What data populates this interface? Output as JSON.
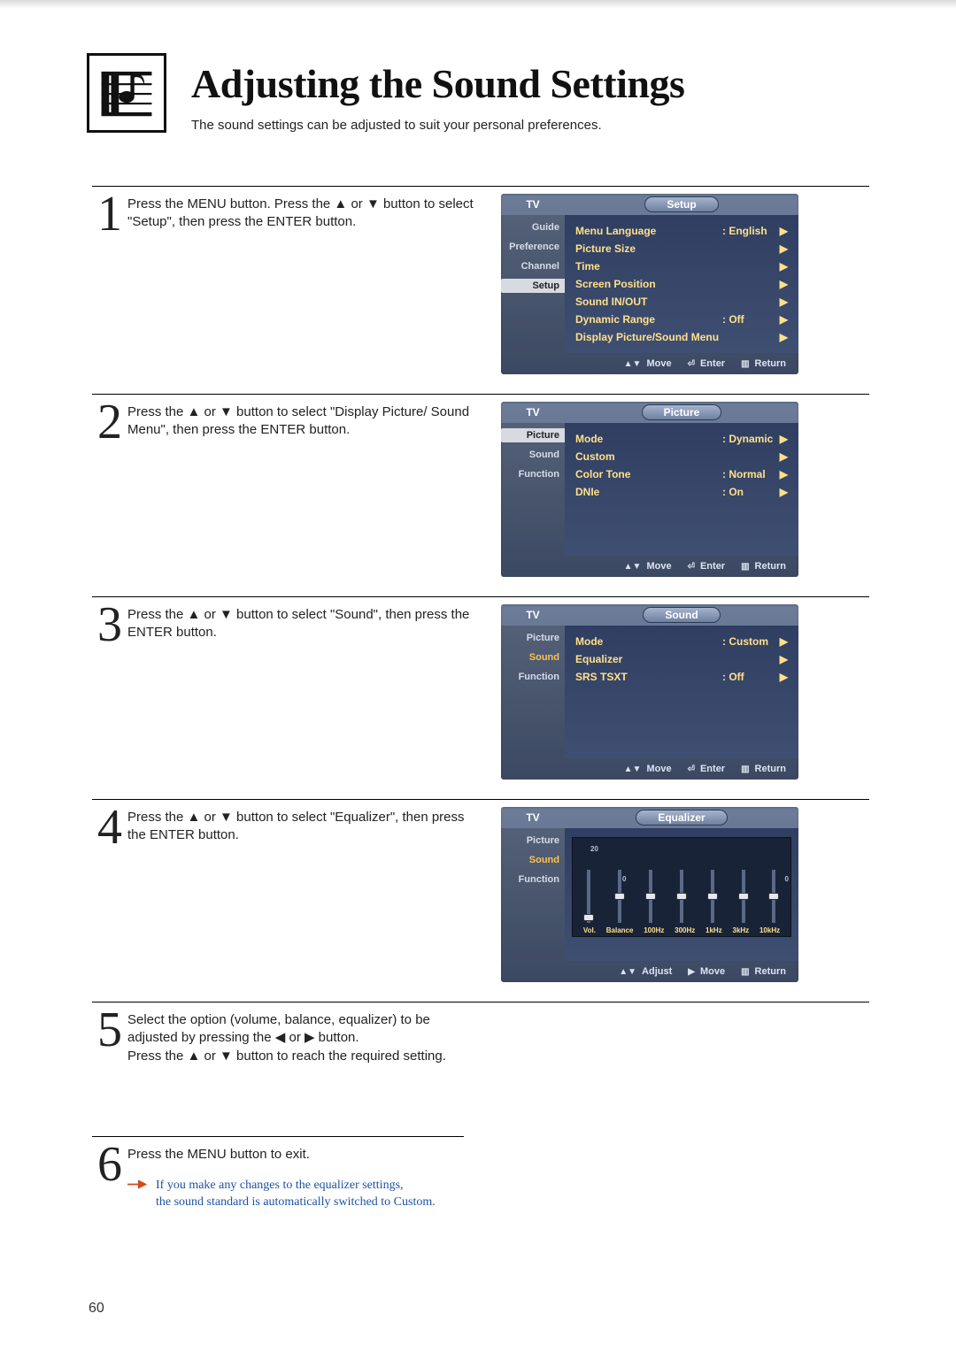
{
  "page_number": "60",
  "header": {
    "title": "Adjusting the Sound Settings",
    "subtitle": "The sound settings can be adjusted to suit your personal preferences."
  },
  "steps": {
    "s1": {
      "num": "1",
      "text": "Press the MENU button. Press the ▲ or ▼ button to select \"Setup\", then press the ENTER button."
    },
    "s2": {
      "num": "2",
      "text": "Press the ▲ or ▼ button to select \"Display Picture/ Sound Menu\", then press the ENTER button."
    },
    "s3": {
      "num": "3",
      "text": "Press the ▲ or ▼ button to select \"Sound\", then press the ENTER button."
    },
    "s4": {
      "num": "4",
      "text": "Press the ▲ or ▼ button to select \"Equalizer\", then press the ENTER button."
    },
    "s5": {
      "num": "5",
      "text": "Select the option (volume, balance, equalizer) to be adjusted by pressing the ◀ or ▶ button.\nPress the ▲ or ▼ button to reach the required setting."
    },
    "s6": {
      "num": "6",
      "text": "Press the MENU button to exit."
    }
  },
  "note": "If you make any changes to the equalizer settings,\nthe sound standard is automatically switched to Custom.",
  "osd1": {
    "tv": "TV",
    "title": "Setup",
    "side": {
      "i0": "Guide",
      "i1": "Preference",
      "i2": "Channel",
      "i3": "Setup"
    },
    "rows": {
      "r0": {
        "label": "Menu Language",
        "val": ":  English"
      },
      "r1": {
        "label": "Picture Size",
        "val": ""
      },
      "r2": {
        "label": "Time",
        "val": ""
      },
      "r3": {
        "label": "Screen Position",
        "val": ""
      },
      "r4": {
        "label": "Sound IN/OUT",
        "val": ""
      },
      "r5": {
        "label": "Dynamic Range",
        "val": ":  Off"
      },
      "r6": {
        "label": "Display Picture/Sound Menu",
        "val": ""
      }
    },
    "footer": {
      "a": "Move",
      "b": "Enter",
      "c": "Return"
    }
  },
  "osd2": {
    "tv": "TV",
    "title": "Picture",
    "side": {
      "i0": "Picture",
      "i1": "Sound",
      "i2": "Function"
    },
    "rows": {
      "r0": {
        "label": "Mode",
        "val": ":  Dynamic"
      },
      "r1": {
        "label": "Custom",
        "val": ""
      },
      "r2": {
        "label": "Color Tone",
        "val": ":  Normal"
      },
      "r3": {
        "label": "DNIe",
        "val": ":  On"
      }
    },
    "footer": {
      "a": "Move",
      "b": "Enter",
      "c": "Return"
    }
  },
  "osd3": {
    "tv": "TV",
    "title": "Sound",
    "side": {
      "i0": "Picture",
      "i1": "Sound",
      "i2": "Function"
    },
    "rows": {
      "r0": {
        "label": "Mode",
        "val": ":  Custom"
      },
      "r1": {
        "label": "Equalizer",
        "val": ""
      },
      "r2": {
        "label": "SRS TSXT",
        "val": ":  Off"
      }
    },
    "footer": {
      "a": "Move",
      "b": "Enter",
      "c": "Return"
    }
  },
  "osd4": {
    "tv": "TV",
    "title": "Equalizer",
    "side": {
      "i0": "Picture",
      "i1": "Sound",
      "i2": "Function"
    },
    "eq": {
      "b0": "Vol.",
      "b1": "Balance",
      "b2": "100Hz",
      "b3": "300Hz",
      "b4": "1kHz",
      "b5": "3kHz",
      "b6": "10kHz"
    },
    "scale_top": "20",
    "scale_mid": "0",
    "footer": {
      "a": "Adjust",
      "b": "Move",
      "c": "Return"
    }
  }
}
